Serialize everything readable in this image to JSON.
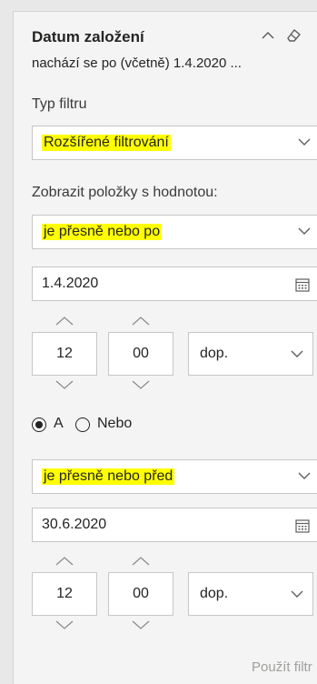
{
  "header": {
    "title": "Datum založení",
    "subtitle": "nachází se po (včetně) 1.4.2020 ...",
    "icons": [
      "chevron-up-icon",
      "eraser-icon"
    ]
  },
  "filter_type": {
    "label": "Typ filtru",
    "value": "Rozšířené filtrování"
  },
  "show_items": {
    "label": "Zobrazit položky s hodnotou:"
  },
  "condition1": {
    "operator": "je přesně nebo po",
    "date": "1.4.2020",
    "hour": "12",
    "minute": "00",
    "ampm": "dop."
  },
  "logic": {
    "and_label": "A",
    "or_label": "Nebo",
    "selected": "A"
  },
  "condition2": {
    "operator": "je přesně nebo před",
    "date": "30.6.2020",
    "hour": "12",
    "minute": "00",
    "ampm": "dop."
  },
  "apply_label": "Použít filtr",
  "colors": {
    "highlight": "#ffff00",
    "border": "#c8c6c4",
    "pane_bg": "#f4f4f4",
    "muted_text": "#a19f9d"
  }
}
